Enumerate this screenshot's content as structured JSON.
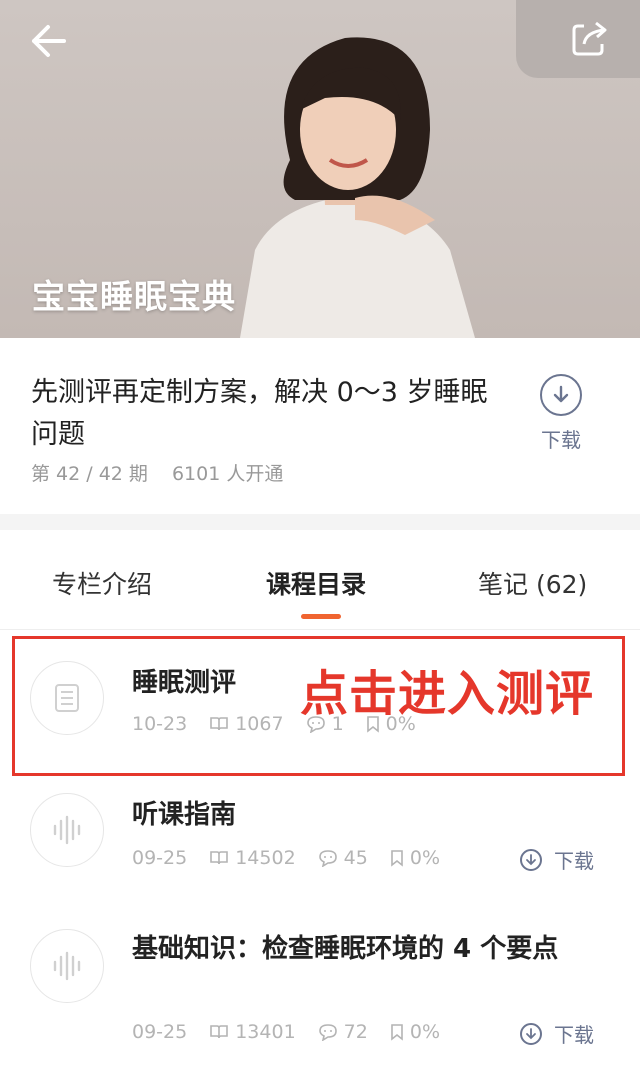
{
  "header": {
    "title": "宝宝睡眠宝典",
    "back_icon": "arrow-left-icon",
    "share_icon": "share-icon"
  },
  "course": {
    "description": "先测评再定制方案，解决 0～3 岁睡眠问题",
    "issue": "第 42 / 42 期",
    "subscribers": "6101 人开通",
    "download_label": "下载"
  },
  "tabs": [
    {
      "label": "专栏介绍",
      "active": false
    },
    {
      "label": "课程目录",
      "active": true
    },
    {
      "label": "笔记 (62)",
      "active": false
    }
  ],
  "lessons": [
    {
      "title": "睡眠测评",
      "date": "10-23",
      "reads": "1067",
      "comments": "1",
      "progress": "0%",
      "icon": "list-icon",
      "download": ""
    },
    {
      "title": "听课指南",
      "date": "09-25",
      "reads": "14502",
      "comments": "45",
      "progress": "0%",
      "icon": "audio-icon",
      "download": "下载"
    },
    {
      "title": "基础知识：检查睡眠环境的 4 个要点",
      "date": "09-25",
      "reads": "13401",
      "comments": "72",
      "progress": "0%",
      "icon": "audio-icon",
      "download": "下载"
    }
  ],
  "annotation": {
    "text": "点击进入测评",
    "color": "#e5372b"
  },
  "colors": {
    "accent": "#f06430",
    "download": "#6b7590"
  }
}
